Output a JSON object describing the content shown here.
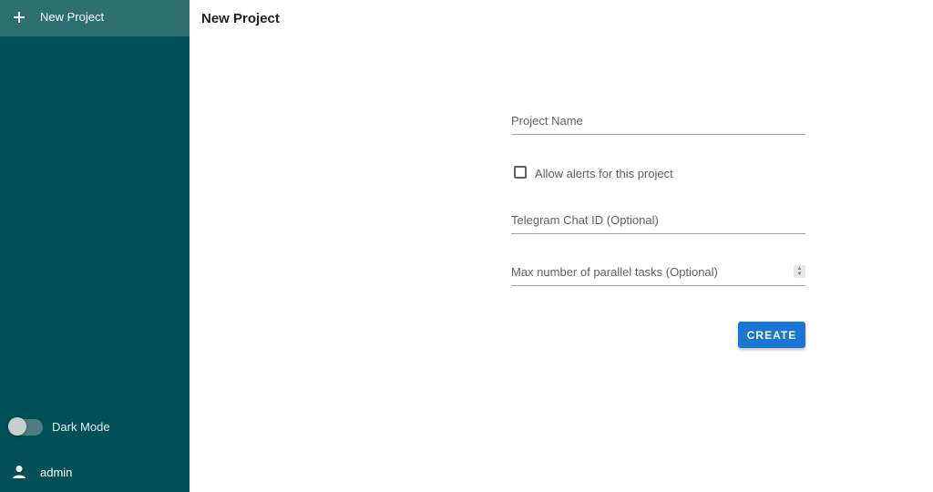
{
  "sidebar": {
    "new_project_label": "New Project",
    "new_project_icon": "plus-icon",
    "dark_mode_label": "Dark Mode",
    "dark_mode_enabled": false,
    "user_name": "admin",
    "user_icon": "person-icon"
  },
  "main": {
    "page_title": "New Project",
    "form": {
      "project_name_placeholder": "Project Name",
      "alerts_label": "Allow alerts for this project",
      "alerts_checked": false,
      "telegram_placeholder": "Telegram Chat ID (Optional)",
      "parallel_tasks_placeholder": "Max number of parallel tasks (Optional)",
      "create_label": "CREATE"
    }
  },
  "colors": {
    "sidebar_bg": "#005057",
    "sidebar_active": "#2e6f73",
    "primary_button": "#1976d2"
  }
}
